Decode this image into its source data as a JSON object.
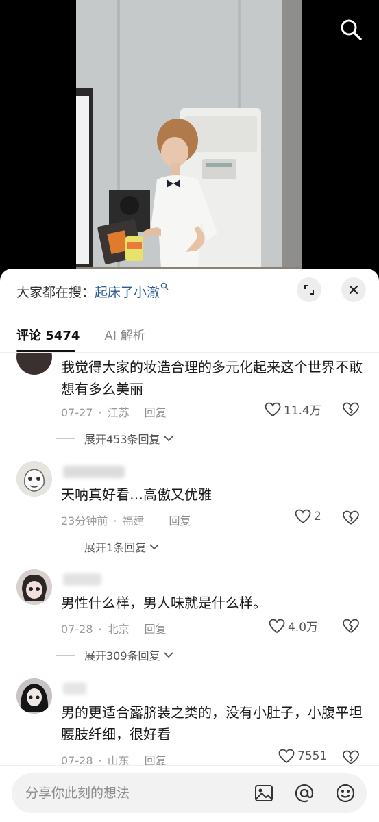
{
  "video": {},
  "sheet": {
    "suggest_prefix": "大家都在搜：",
    "suggest_link": "起床了小澈"
  },
  "tabs": [
    {
      "label": "评论 5474",
      "active": true
    },
    {
      "label": "AI 解析",
      "active": false
    }
  ],
  "comments": [
    {
      "text": "我觉得大家的妆造合理的多元化起来这个世界不敢想有多么美丽",
      "date": "07-27",
      "location": "江苏",
      "reply_label": "回复",
      "likes": "11.4万",
      "expand_label": "展开453条回复"
    },
    {
      "text": "天呐真好看…高傲又优雅",
      "date": "23分钟前",
      "location": "福建",
      "reply_label": "回复",
      "likes": "2",
      "expand_label": "展开1条回复"
    },
    {
      "text": "男性什么样，男人味就是什么样。",
      "date": "07-28",
      "location": "北京",
      "reply_label": "回复",
      "likes": "4.0万",
      "expand_label": "展开309条回复"
    },
    {
      "text": "男的更适合露脐装之类的，没有小肚子，小腹平坦腰肢纤细，很好看",
      "date": "07-28",
      "location": "山东",
      "reply_label": "回复",
      "likes": "7551"
    }
  ],
  "input": {
    "placeholder": "分享你此刻的想法"
  },
  "icons": [
    "search-icon",
    "expand-icon",
    "close-icon",
    "heart-icon",
    "broken-heart-icon",
    "chevron-down-icon",
    "image-icon",
    "at-icon",
    "emoji-icon"
  ],
  "colors": {
    "link": "#2c5f9a",
    "sheet_bg": "#ffffff",
    "input_bg": "#f2f2f2"
  }
}
